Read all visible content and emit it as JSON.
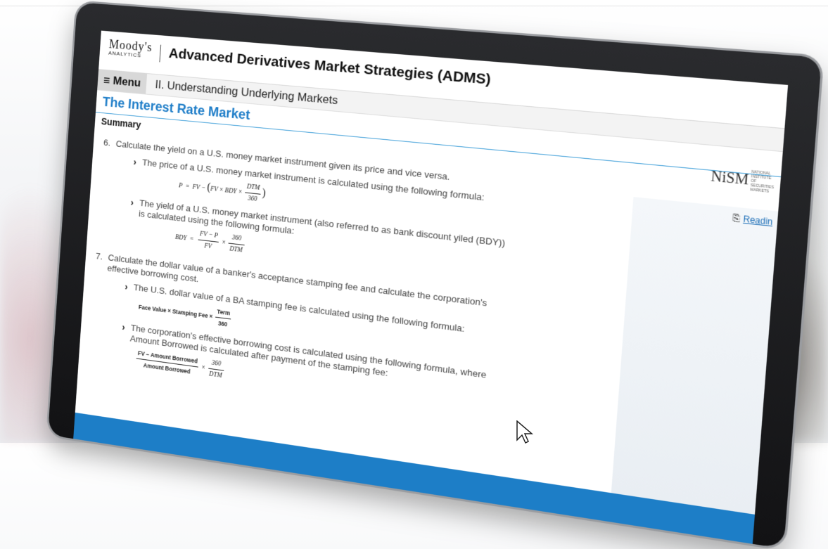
{
  "header": {
    "logo_main": "Moody's",
    "logo_sub": "ANALYTICS",
    "course_title": "Advanced Derivatives Market Strategies (ADMS)"
  },
  "nav": {
    "menu_label": "Menu",
    "breadcrumb": "II. Understanding Underlying Markets"
  },
  "page": {
    "title": "The Interest Rate Market",
    "section": "Summary",
    "partner_logo": "NiSM",
    "partner_sub": "NATIONAL INSTITUTE OF SECURITIES MARKETS",
    "reading_link": "Readin"
  },
  "items": [
    {
      "num": "6.",
      "text": "Calculate the yield on a U.S. money market instrument given its price and vice versa.",
      "subs": [
        {
          "text": "The price of a U.S. money market instrument is calculated using the following formula:",
          "formula": {
            "lhs": "P",
            "eq": "=",
            "fv": "FV",
            "minus": "−",
            "open": "(",
            "inner": "FV × BDY ×",
            "num": "DTM",
            "den": "360",
            "close": ")"
          }
        },
        {
          "text": "The yield of a U.S. money market instrument (also referred to as bank discount yiled (BDY)) is calculated using the following formula:",
          "formula": {
            "lhs": "BDY",
            "eq": "=",
            "num1": "FV − P",
            "den1": "FV",
            "times": "×",
            "num2": "360",
            "den2": "DTM"
          }
        }
      ]
    },
    {
      "num": "7.",
      "text": "Calculate the dollar value of a banker's acceptance stamping fee and calculate the corporation's effective borrowing cost.",
      "subs": [
        {
          "text": "The U.S. dollar value of a BA stamping fee is calculated using the following formula:",
          "formula": {
            "lead": "Face Value × Stamping Fee ×",
            "num": "Term",
            "den": "360"
          }
        },
        {
          "text": "The corporation's effective borrowing cost is calculated using the following formula, where Amount Borrowed is calculated after payment of the stamping fee:",
          "formula": {
            "num1": "FV − Amount Borrowed",
            "den1": "Amount Borrowed",
            "times": "×",
            "num2": "360",
            "den2": "DTM"
          }
        }
      ]
    }
  ],
  "colors": {
    "accent": "#1e7dc8",
    "bottom_bar": "#1d7ec7",
    "bezel": "#1b1c1f"
  }
}
